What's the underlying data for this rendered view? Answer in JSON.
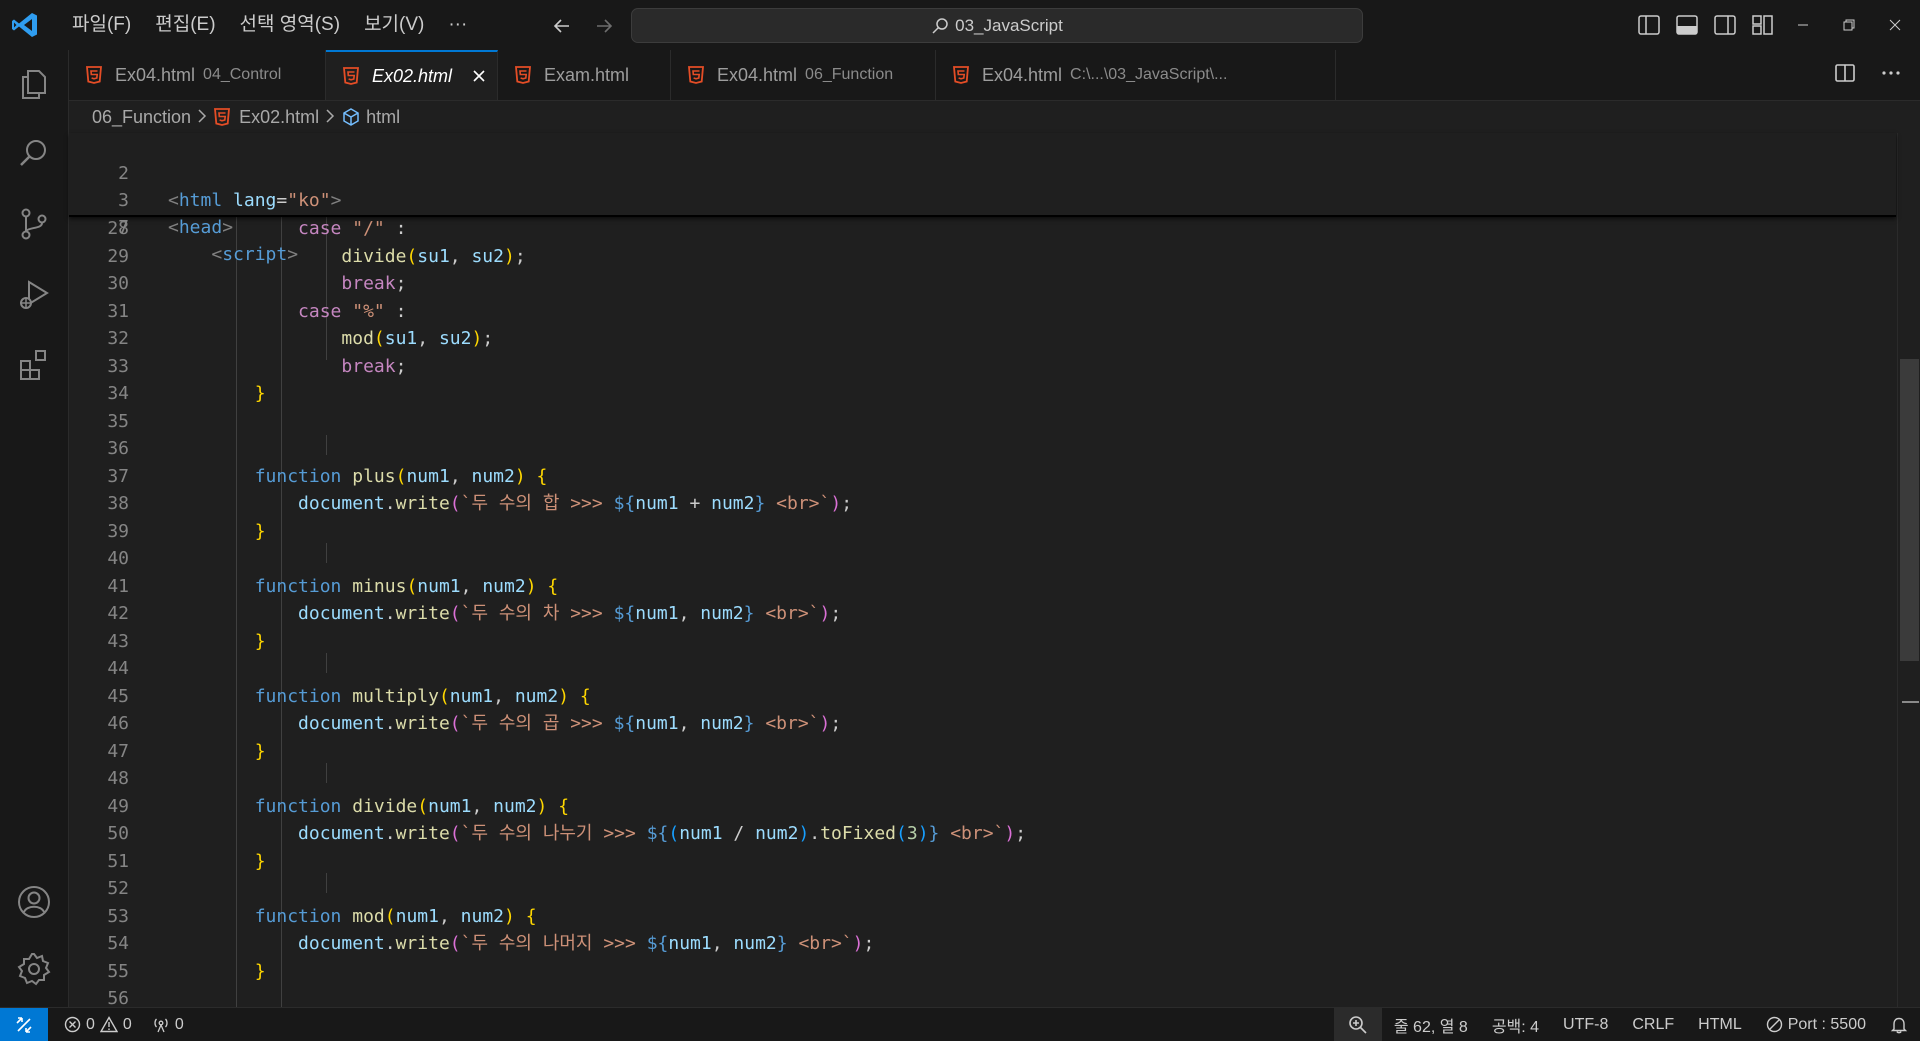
{
  "title_bar": {
    "menu": [
      "파일(F)",
      "편집(E)",
      "선택 영역(S)",
      "보기(V)",
      "···"
    ],
    "search_text": "03_JavaScript"
  },
  "tabs": [
    {
      "name": "Ex04.html",
      "desc": "04_Control",
      "active": false
    },
    {
      "name": "Ex02.html",
      "desc": "",
      "active": true
    },
    {
      "name": "Exam.html",
      "desc": "",
      "active": false
    },
    {
      "name": "Ex04.html",
      "desc": "06_Function",
      "active": false
    },
    {
      "name": "Ex04.html",
      "desc": "C:\\...\\03_JavaScript\\...",
      "active": false
    }
  ],
  "breadcrumb": [
    "06_Function",
    "Ex02.html",
    "html"
  ],
  "sticky_lines": [
    {
      "n": "2",
      "t": "html_open"
    },
    {
      "n": "3",
      "t": "head"
    },
    {
      "n": "7",
      "t": "script"
    }
  ],
  "code_lines": [
    {
      "n": "28",
      "text": "case \"/\" :"
    },
    {
      "n": "29",
      "text": "divide(su1, su2);"
    },
    {
      "n": "30",
      "text": "break;"
    },
    {
      "n": "31",
      "text": "case \"%\" :"
    },
    {
      "n": "32",
      "text": "mod(su1, su2);"
    },
    {
      "n": "33",
      "text": "break;"
    },
    {
      "n": "34",
      "text": "}"
    },
    {
      "n": "35",
      "text": ""
    },
    {
      "n": "36",
      "text": ""
    },
    {
      "n": "37",
      "text": "function plus(num1, num2) {"
    },
    {
      "n": "38",
      "text": "document.write(`두 수의 합 >>> ${num1 + num2} <br>`);"
    },
    {
      "n": "39",
      "text": "}"
    },
    {
      "n": "40",
      "text": ""
    },
    {
      "n": "41",
      "text": "function minus(num1, num2) {"
    },
    {
      "n": "42",
      "text": "document.write(`두 수의 차 >>> ${num1, num2} <br>`);"
    },
    {
      "n": "43",
      "text": "}"
    },
    {
      "n": "44",
      "text": ""
    },
    {
      "n": "45",
      "text": "function multiply(num1, num2) {"
    },
    {
      "n": "46",
      "text": "document.write(`두 수의 곱 >>> ${num1, num2} <br>`);"
    },
    {
      "n": "47",
      "text": "}"
    },
    {
      "n": "48",
      "text": ""
    },
    {
      "n": "49",
      "text": "function divide(num1, num2) {"
    },
    {
      "n": "50",
      "text": "document.write(`두 수의 나누기 >>> ${(num1 / num2).toFixed(3)} <br>`);"
    },
    {
      "n": "51",
      "text": "}"
    },
    {
      "n": "52",
      "text": ""
    },
    {
      "n": "53",
      "text": "function mod(num1, num2) {"
    },
    {
      "n": "54",
      "text": "document.write(`두 수의 나머지 >>> ${num1, num2} <br>`);"
    },
    {
      "n": "55",
      "text": "}"
    },
    {
      "n": "56",
      "text": ""
    }
  ],
  "status_bar": {
    "errors": "0",
    "warnings": "0",
    "ports": "0",
    "position": "줄 62, 열 8",
    "spaces": "공백: 4",
    "encoding": "UTF-8",
    "eol": "CRLF",
    "language": "HTML",
    "port": "Port : 5500"
  },
  "colors": {
    "accent": "#0078d4",
    "html_icon": "#e44d26",
    "keyword": "#569cd6",
    "control": "#c586c0",
    "function": "#dcdcaa",
    "variable": "#9cdcfe",
    "string": "#ce9178"
  }
}
